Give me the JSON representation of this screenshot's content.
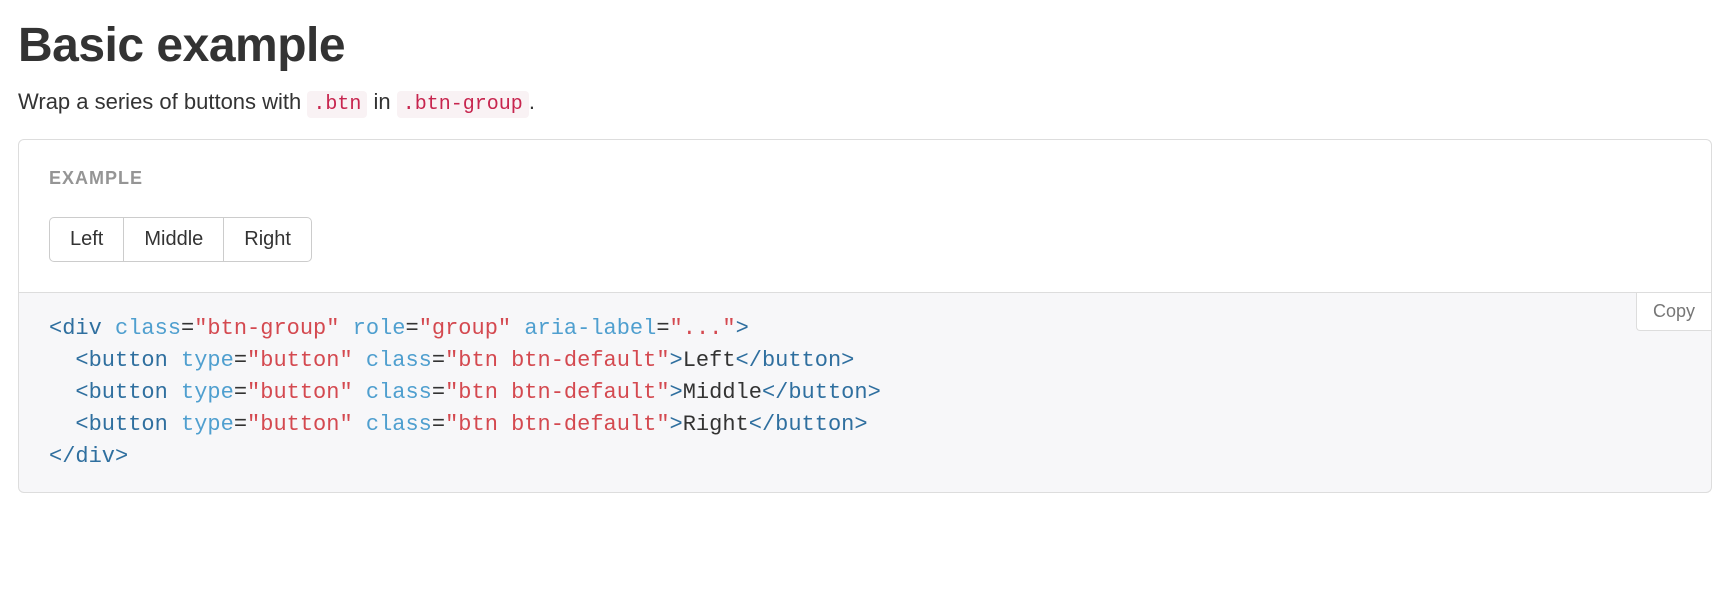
{
  "heading": "Basic example",
  "intro": {
    "before": "Wrap a series of buttons with ",
    "code1": ".btn",
    "mid": " in ",
    "code2": ".btn-group",
    "after": "."
  },
  "exampleLabel": "EXAMPLE",
  "buttons": {
    "left": "Left",
    "middle": "Middle",
    "right": "Right"
  },
  "copyLabel": "Copy",
  "code": {
    "indent": "  ",
    "openDiv": {
      "tag": "div",
      "classAttr": "class",
      "classVal": "\"btn-group\"",
      "roleAttr": "role",
      "roleVal": "\"group\"",
      "ariaAttr": "aria-label",
      "ariaVal": "\"...\""
    },
    "btnLine": {
      "tag": "button",
      "typeAttr": "type",
      "typeVal": "\"button\"",
      "classAttr": "class",
      "classVal": "\"btn btn-default\""
    },
    "texts": {
      "left": "Left",
      "middle": "Middle",
      "right": "Right"
    },
    "closeDiv": "div"
  }
}
